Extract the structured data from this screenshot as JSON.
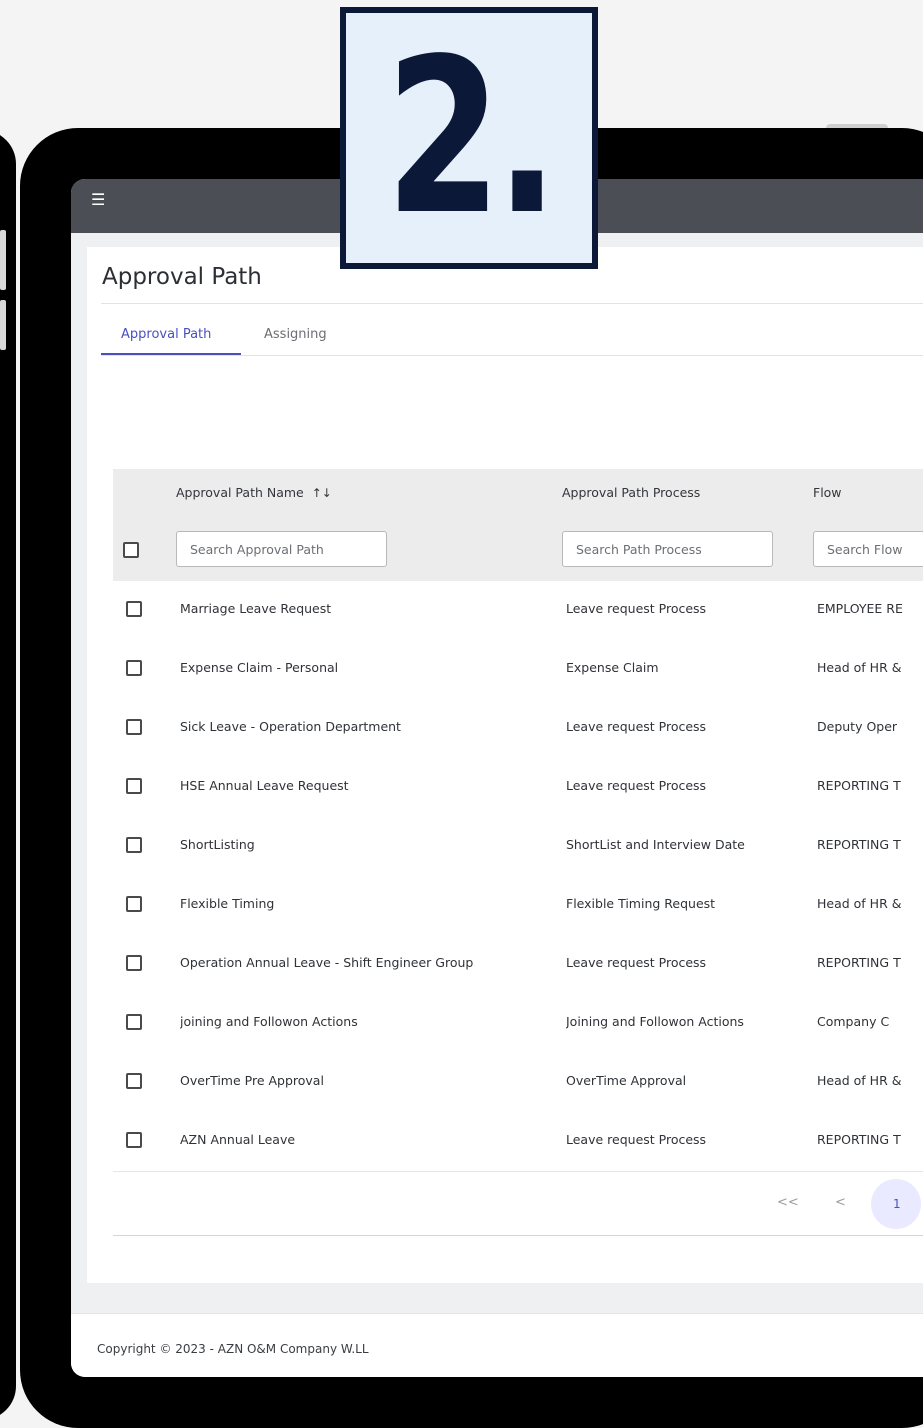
{
  "badge": {
    "number": "2."
  },
  "header": {
    "menu_icon": "menu-icon"
  },
  "page": {
    "title": "Approval Path",
    "tabs": [
      {
        "label": "Approval Path",
        "active": true
      },
      {
        "label": "Assigning",
        "active": false
      }
    ]
  },
  "table": {
    "columns": [
      "Approval Path Name",
      "Approval Path Process",
      "Flow"
    ],
    "sort_icon": "↑↓",
    "filters": {
      "name_placeholder": "Search Approval Path",
      "process_placeholder": "Search Path Process",
      "flow_placeholder": "Search Flow"
    },
    "rows": [
      {
        "name": "Marriage Leave Request",
        "process": "Leave request Process",
        "flow": "EMPLOYEE RE"
      },
      {
        "name": "Expense Claim - Personal",
        "process": "Expense Claim",
        "flow": "Head of HR &"
      },
      {
        "name": "Sick Leave - Operation Department",
        "process": "Leave request Process",
        "flow": "Deputy Oper"
      },
      {
        "name": "HSE Annual Leave Request",
        "process": "Leave request Process",
        "flow": "REPORTING T"
      },
      {
        "name": "ShortListing",
        "process": "ShortList and Interview Date",
        "flow": "REPORTING T"
      },
      {
        "name": "Flexible Timing",
        "process": "Flexible Timing Request",
        "flow": "Head of HR &"
      },
      {
        "name": "Operation Annual Leave - Shift Engineer Group",
        "process": "Leave request Process",
        "flow": "REPORTING T"
      },
      {
        "name": "joining and Followon Actions",
        "process": "Joining and Followon Actions",
        "flow": "Company C"
      },
      {
        "name": "OverTime Pre Approval",
        "process": "OverTime Approval",
        "flow": "Head of HR &"
      },
      {
        "name": "AZN Annual Leave",
        "process": "Leave request Process",
        "flow": "REPORTING T"
      }
    ]
  },
  "pagination": {
    "first": "<<",
    "prev": "<",
    "current": "1"
  },
  "footer": {
    "copyright": "Copyright © 2023 - AZN O&M Company W.LL"
  },
  "colors": {
    "accent": "#4a4fc0",
    "topbar": "#4b4e55",
    "badge_border": "#0c1838",
    "badge_fill": "#e6f0fb"
  }
}
